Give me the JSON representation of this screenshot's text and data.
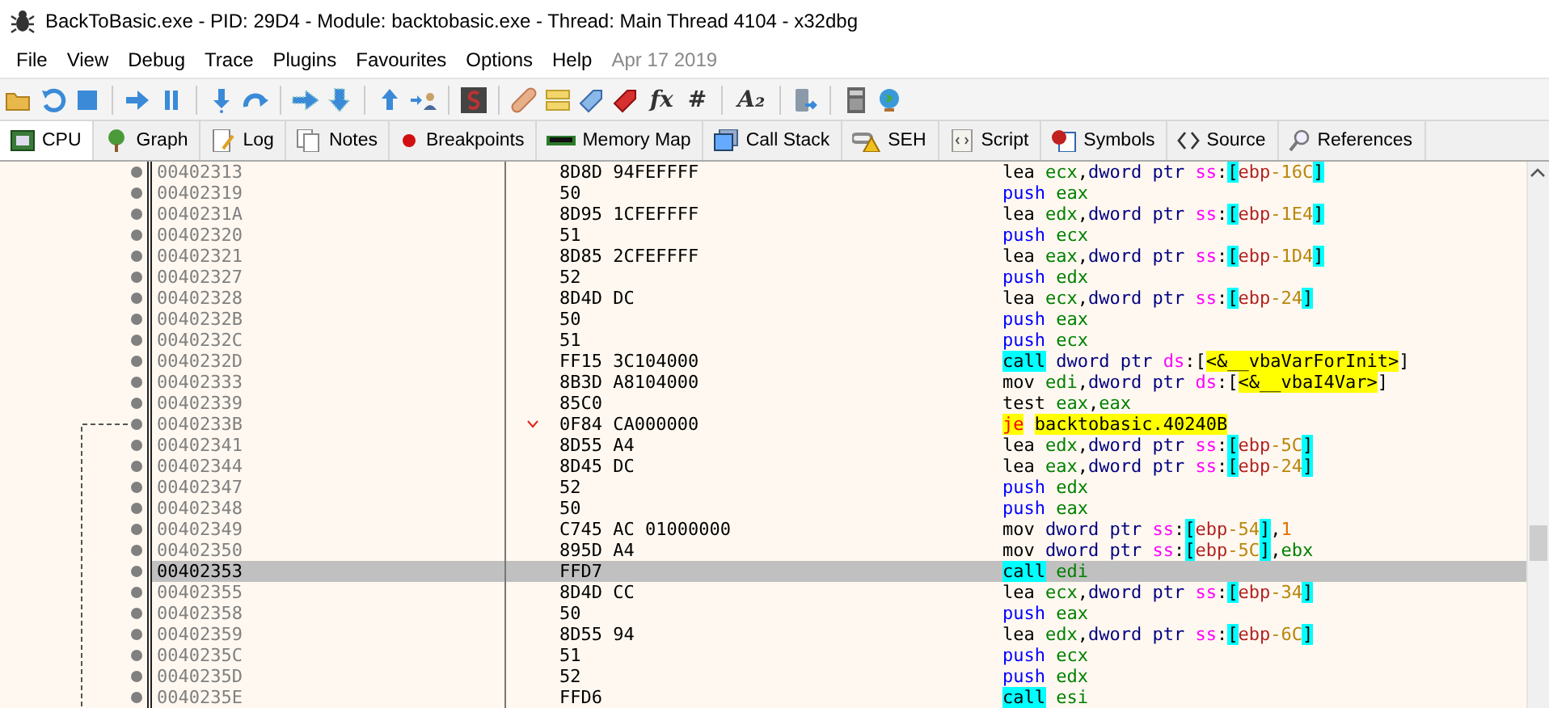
{
  "window": {
    "title": "BackToBasic.exe - PID: 29D4 - Module: backtobasic.exe - Thread: Main Thread 4104 - x32dbg"
  },
  "menu": [
    "File",
    "View",
    "Debug",
    "Trace",
    "Plugins",
    "Favourites",
    "Options",
    "Help"
  ],
  "build_date": "Apr 17 2019",
  "toolbar": [
    {
      "kind": "folder"
    },
    {
      "kind": "restart"
    },
    {
      "kind": "stop"
    },
    {
      "kind": "separator"
    },
    {
      "kind": "run"
    },
    {
      "kind": "pause"
    },
    {
      "kind": "separator"
    },
    {
      "kind": "step-into"
    },
    {
      "kind": "step-over"
    },
    {
      "kind": "separator"
    },
    {
      "kind": "trace-into"
    },
    {
      "kind": "trace-over"
    },
    {
      "kind": "separator"
    },
    {
      "kind": "step-out"
    },
    {
      "kind": "run-user"
    },
    {
      "kind": "separator"
    },
    {
      "kind": "scylla"
    },
    {
      "kind": "separator"
    },
    {
      "kind": "patch"
    },
    {
      "kind": "comments"
    },
    {
      "kind": "labels"
    },
    {
      "kind": "bookmarks"
    },
    {
      "kind": "text",
      "label": "fx"
    },
    {
      "kind": "text",
      "label": "#"
    },
    {
      "kind": "separator"
    },
    {
      "kind": "text",
      "label": "A₂"
    },
    {
      "kind": "separator"
    },
    {
      "kind": "device"
    },
    {
      "kind": "separator"
    },
    {
      "kind": "calculator"
    },
    {
      "kind": "globe"
    }
  ],
  "tabs": [
    {
      "label": "CPU",
      "kind": "cpu",
      "selected": true
    },
    {
      "label": "Graph",
      "kind": "tree",
      "selected": false
    },
    {
      "label": "Log",
      "kind": "log",
      "selected": false
    },
    {
      "label": "Notes",
      "kind": "notes",
      "selected": false
    },
    {
      "label": "Breakpoints",
      "kind": "dot",
      "selected": false
    },
    {
      "label": "Memory Map",
      "kind": "memory",
      "selected": false
    },
    {
      "label": "Call Stack",
      "kind": "stack",
      "selected": false
    },
    {
      "label": "SEH",
      "kind": "seh",
      "selected": false
    },
    {
      "label": "Script",
      "kind": "script",
      "selected": false
    },
    {
      "label": "Symbols",
      "kind": "symbols",
      "selected": false
    },
    {
      "label": "Source",
      "kind": "source",
      "selected": false
    },
    {
      "label": "References",
      "kind": "search",
      "selected": false
    }
  ],
  "disassembly": [
    {
      "address": "00402313",
      "bytes": "8D8D 94FEFFFF",
      "branch": false,
      "selected": false,
      "instruction": [
        {
          "kind": "op",
          "text": "lea"
        },
        {
          "kind": "reg",
          "text": "ecx"
        },
        {
          "kind": "punct",
          "text": ","
        },
        {
          "kind": "size",
          "text": "dword ptr"
        },
        {
          "kind": "seg",
          "text": "ss"
        },
        {
          "kind": "punct",
          "text": ":"
        },
        {
          "kind": "mbr",
          "text": "["
        },
        {
          "kind": "base",
          "text": "ebp"
        },
        {
          "kind": "off",
          "text": "-16C"
        },
        {
          "kind": "mbr",
          "text": "]"
        }
      ]
    },
    {
      "address": "00402319",
      "bytes": "50",
      "branch": false,
      "selected": false,
      "instruction": [
        {
          "kind": "push",
          "text": "push"
        },
        {
          "kind": "reg",
          "text": "eax"
        }
      ]
    },
    {
      "address": "0040231A",
      "bytes": "8D95 1CFEFFFF",
      "branch": false,
      "selected": false,
      "instruction": [
        {
          "kind": "op",
          "text": "lea"
        },
        {
          "kind": "reg",
          "text": "edx"
        },
        {
          "kind": "punct",
          "text": ","
        },
        {
          "kind": "size",
          "text": "dword ptr"
        },
        {
          "kind": "seg",
          "text": "ss"
        },
        {
          "kind": "punct",
          "text": ":"
        },
        {
          "kind": "mbr",
          "text": "["
        },
        {
          "kind": "base",
          "text": "ebp"
        },
        {
          "kind": "off",
          "text": "-1E4"
        },
        {
          "kind": "mbr",
          "text": "]"
        }
      ]
    },
    {
      "address": "00402320",
      "bytes": "51",
      "branch": false,
      "selected": false,
      "instruction": [
        {
          "kind": "push",
          "text": "push"
        },
        {
          "kind": "reg",
          "text": "ecx"
        }
      ]
    },
    {
      "address": "00402321",
      "bytes": "8D85 2CFEFFFF",
      "branch": false,
      "selected": false,
      "instruction": [
        {
          "kind": "op",
          "text": "lea"
        },
        {
          "kind": "reg",
          "text": "eax"
        },
        {
          "kind": "punct",
          "text": ","
        },
        {
          "kind": "size",
          "text": "dword ptr"
        },
        {
          "kind": "seg",
          "text": "ss"
        },
        {
          "kind": "punct",
          "text": ":"
        },
        {
          "kind": "mbr",
          "text": "["
        },
        {
          "kind": "base",
          "text": "ebp"
        },
        {
          "kind": "off",
          "text": "-1D4"
        },
        {
          "kind": "mbr",
          "text": "]"
        }
      ]
    },
    {
      "address": "00402327",
      "bytes": "52",
      "branch": false,
      "selected": false,
      "instruction": [
        {
          "kind": "push",
          "text": "push"
        },
        {
          "kind": "reg",
          "text": "edx"
        }
      ]
    },
    {
      "address": "00402328",
      "bytes": "8D4D DC",
      "branch": false,
      "selected": false,
      "instruction": [
        {
          "kind": "op",
          "text": "lea"
        },
        {
          "kind": "reg",
          "text": "ecx"
        },
        {
          "kind": "punct",
          "text": ","
        },
        {
          "kind": "size",
          "text": "dword ptr"
        },
        {
          "kind": "seg",
          "text": "ss"
        },
        {
          "kind": "punct",
          "text": ":"
        },
        {
          "kind": "mbr",
          "text": "["
        },
        {
          "kind": "base",
          "text": "ebp"
        },
        {
          "kind": "off",
          "text": "-24"
        },
        {
          "kind": "mbr",
          "text": "]"
        }
      ]
    },
    {
      "address": "0040232B",
      "bytes": "50",
      "branch": false,
      "selected": false,
      "instruction": [
        {
          "kind": "push",
          "text": "push"
        },
        {
          "kind": "reg",
          "text": "eax"
        }
      ]
    },
    {
      "address": "0040232C",
      "bytes": "51",
      "branch": false,
      "selected": false,
      "instruction": [
        {
          "kind": "push",
          "text": "push"
        },
        {
          "kind": "reg",
          "text": "ecx"
        }
      ]
    },
    {
      "address": "0040232D",
      "bytes": "FF15 3C104000",
      "branch": false,
      "selected": false,
      "instruction": [
        {
          "kind": "call",
          "text": "call"
        },
        {
          "kind": "size",
          "text": "dword ptr"
        },
        {
          "kind": "seg",
          "text": "ds"
        },
        {
          "kind": "punct",
          "text": ":["
        },
        {
          "kind": "sym",
          "text": "<&__vbaVarForInit>"
        },
        {
          "kind": "punct",
          "text": "]"
        }
      ]
    },
    {
      "address": "00402333",
      "bytes": "8B3D A8104000",
      "branch": false,
      "selected": false,
      "instruction": [
        {
          "kind": "op",
          "text": "mov"
        },
        {
          "kind": "reg",
          "text": "edi"
        },
        {
          "kind": "punct",
          "text": ","
        },
        {
          "kind": "size",
          "text": "dword ptr"
        },
        {
          "kind": "seg",
          "text": "ds"
        },
        {
          "kind": "punct",
          "text": ":["
        },
        {
          "kind": "sym",
          "text": "<&__vbaI4Var>"
        },
        {
          "kind": "punct",
          "text": "]"
        }
      ]
    },
    {
      "address": "00402339",
      "bytes": "85C0",
      "branch": false,
      "selected": false,
      "instruction": [
        {
          "kind": "op",
          "text": "test"
        },
        {
          "kind": "reg",
          "text": "eax"
        },
        {
          "kind": "punct",
          "text": ","
        },
        {
          "kind": "reg",
          "text": "eax"
        }
      ]
    },
    {
      "address": "0040233B",
      "bytes": "0F84 CA000000",
      "branch": true,
      "selected": false,
      "instruction": [
        {
          "kind": "jcc",
          "text": "je"
        },
        {
          "kind": "sym",
          "text": "backtobasic.40240B"
        }
      ]
    },
    {
      "address": "00402341",
      "bytes": "8D55 A4",
      "branch": false,
      "selected": false,
      "instruction": [
        {
          "kind": "op",
          "text": "lea"
        },
        {
          "kind": "reg",
          "text": "edx"
        },
        {
          "kind": "punct",
          "text": ","
        },
        {
          "kind": "size",
          "text": "dword ptr"
        },
        {
          "kind": "seg",
          "text": "ss"
        },
        {
          "kind": "punct",
          "text": ":"
        },
        {
          "kind": "mbr",
          "text": "["
        },
        {
          "kind": "base",
          "text": "ebp"
        },
        {
          "kind": "off",
          "text": "-5C"
        },
        {
          "kind": "mbr",
          "text": "]"
        }
      ]
    },
    {
      "address": "00402344",
      "bytes": "8D45 DC",
      "branch": false,
      "selected": false,
      "instruction": [
        {
          "kind": "op",
          "text": "lea"
        },
        {
          "kind": "reg",
          "text": "eax"
        },
        {
          "kind": "punct",
          "text": ","
        },
        {
          "kind": "size",
          "text": "dword ptr"
        },
        {
          "kind": "seg",
          "text": "ss"
        },
        {
          "kind": "punct",
          "text": ":"
        },
        {
          "kind": "mbr",
          "text": "["
        },
        {
          "kind": "base",
          "text": "ebp"
        },
        {
          "kind": "off",
          "text": "-24"
        },
        {
          "kind": "mbr",
          "text": "]"
        }
      ]
    },
    {
      "address": "00402347",
      "bytes": "52",
      "branch": false,
      "selected": false,
      "instruction": [
        {
          "kind": "push",
          "text": "push"
        },
        {
          "kind": "reg",
          "text": "edx"
        }
      ]
    },
    {
      "address": "00402348",
      "bytes": "50",
      "branch": false,
      "selected": false,
      "instruction": [
        {
          "kind": "push",
          "text": "push"
        },
        {
          "kind": "reg",
          "text": "eax"
        }
      ]
    },
    {
      "address": "00402349",
      "bytes": "C745 AC 01000000",
      "branch": false,
      "selected": false,
      "instruction": [
        {
          "kind": "op",
          "text": "mov"
        },
        {
          "kind": "size",
          "text": "dword ptr"
        },
        {
          "kind": "seg",
          "text": "ss"
        },
        {
          "kind": "punct",
          "text": ":"
        },
        {
          "kind": "mbr",
          "text": "["
        },
        {
          "kind": "base",
          "text": "ebp"
        },
        {
          "kind": "off",
          "text": "-54"
        },
        {
          "kind": "mbr",
          "text": "]"
        },
        {
          "kind": "punct",
          "text": ","
        },
        {
          "kind": "imm",
          "text": "1"
        }
      ]
    },
    {
      "address": "00402350",
      "bytes": "895D A4",
      "branch": false,
      "selected": false,
      "instruction": [
        {
          "kind": "op",
          "text": "mov"
        },
        {
          "kind": "size",
          "text": "dword ptr"
        },
        {
          "kind": "seg",
          "text": "ss"
        },
        {
          "kind": "punct",
          "text": ":"
        },
        {
          "kind": "mbr",
          "text": "["
        },
        {
          "kind": "base",
          "text": "ebp"
        },
        {
          "kind": "off",
          "text": "-5C"
        },
        {
          "kind": "mbr",
          "text": "]"
        },
        {
          "kind": "punct",
          "text": ","
        },
        {
          "kind": "reg",
          "text": "ebx"
        }
      ]
    },
    {
      "address": "00402353",
      "bytes": "FFD7",
      "branch": false,
      "selected": true,
      "instruction": [
        {
          "kind": "call",
          "text": "call"
        },
        {
          "kind": "reg",
          "text": "edi"
        }
      ]
    },
    {
      "address": "00402355",
      "bytes": "8D4D CC",
      "branch": false,
      "selected": false,
      "instruction": [
        {
          "kind": "op",
          "text": "lea"
        },
        {
          "kind": "reg",
          "text": "ecx"
        },
        {
          "kind": "punct",
          "text": ","
        },
        {
          "kind": "size",
          "text": "dword ptr"
        },
        {
          "kind": "seg",
          "text": "ss"
        },
        {
          "kind": "punct",
          "text": ":"
        },
        {
          "kind": "mbr",
          "text": "["
        },
        {
          "kind": "base",
          "text": "ebp"
        },
        {
          "kind": "off",
          "text": "-34"
        },
        {
          "kind": "mbr",
          "text": "]"
        }
      ]
    },
    {
      "address": "00402358",
      "bytes": "50",
      "branch": false,
      "selected": false,
      "instruction": [
        {
          "kind": "push",
          "text": "push"
        },
        {
          "kind": "reg",
          "text": "eax"
        }
      ]
    },
    {
      "address": "00402359",
      "bytes": "8D55 94",
      "branch": false,
      "selected": false,
      "instruction": [
        {
          "kind": "op",
          "text": "lea"
        },
        {
          "kind": "reg",
          "text": "edx"
        },
        {
          "kind": "punct",
          "text": ","
        },
        {
          "kind": "size",
          "text": "dword ptr"
        },
        {
          "kind": "seg",
          "text": "ss"
        },
        {
          "kind": "punct",
          "text": ":"
        },
        {
          "kind": "mbr",
          "text": "["
        },
        {
          "kind": "base",
          "text": "ebp"
        },
        {
          "kind": "off",
          "text": "-6C"
        },
        {
          "kind": "mbr",
          "text": "]"
        }
      ]
    },
    {
      "address": "0040235C",
      "bytes": "51",
      "branch": false,
      "selected": false,
      "instruction": [
        {
          "kind": "push",
          "text": "push"
        },
        {
          "kind": "reg",
          "text": "ecx"
        }
      ]
    },
    {
      "address": "0040235D",
      "bytes": "52",
      "branch": false,
      "selected": false,
      "instruction": [
        {
          "kind": "push",
          "text": "push"
        },
        {
          "kind": "reg",
          "text": "edx"
        }
      ]
    },
    {
      "address": "0040235E",
      "bytes": "FFD6",
      "branch": false,
      "selected": false,
      "instruction": [
        {
          "kind": "call",
          "text": "call"
        },
        {
          "kind": "reg",
          "text": "esi"
        }
      ]
    }
  ]
}
